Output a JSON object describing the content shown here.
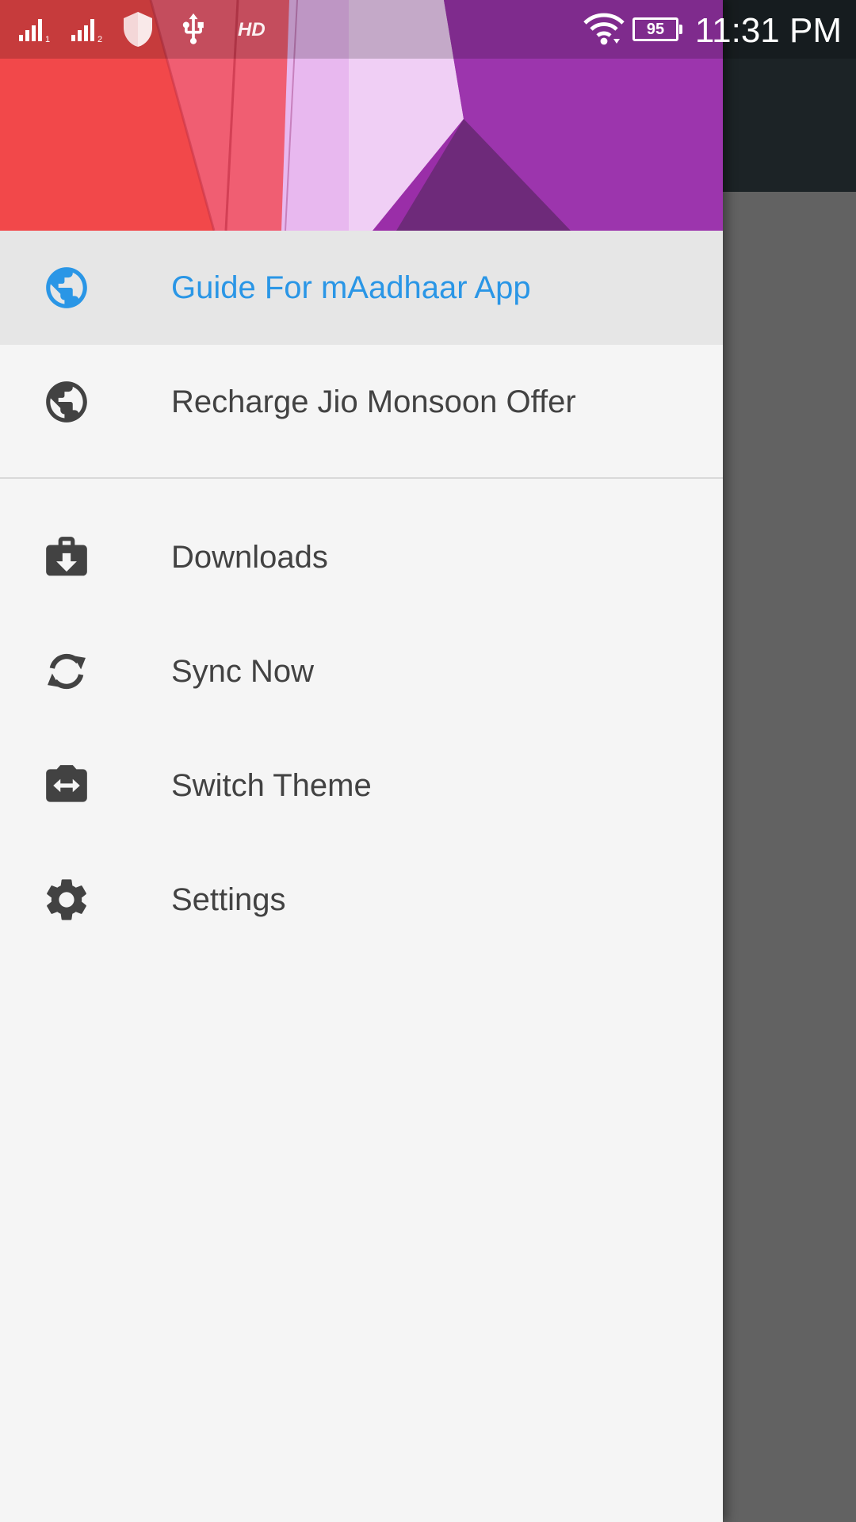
{
  "status_bar": {
    "time": "11:31 PM",
    "battery_level": "95",
    "hd_label": "HD",
    "icons": [
      "signal-sim1-icon",
      "signal-sim2-icon",
      "shield-icon",
      "usb-icon",
      "wifi-icon",
      "battery-icon"
    ]
  },
  "drawer": {
    "header_colors": {
      "red": "#f2484a",
      "pink": "#f05e72",
      "lilac": "#e8b8ef",
      "purple": "#9a2ea8",
      "dark_purple": "#6e2a7a"
    },
    "accent_color": "#2a96e6",
    "menu": [
      {
        "label": "Guide For mAadhaar App",
        "icon": "globe-icon",
        "selected": true
      },
      {
        "label": "Recharge Jio Monsoon Offer",
        "icon": "globe-icon",
        "selected": false
      },
      {
        "label": "Downloads",
        "icon": "download-briefcase-icon",
        "selected": false
      },
      {
        "label": "Sync Now",
        "icon": "sync-icon",
        "selected": false
      },
      {
        "label": "Switch Theme",
        "icon": "switch-camera-icon",
        "selected": false
      },
      {
        "label": "Settings",
        "icon": "gear-icon",
        "selected": false
      }
    ]
  }
}
